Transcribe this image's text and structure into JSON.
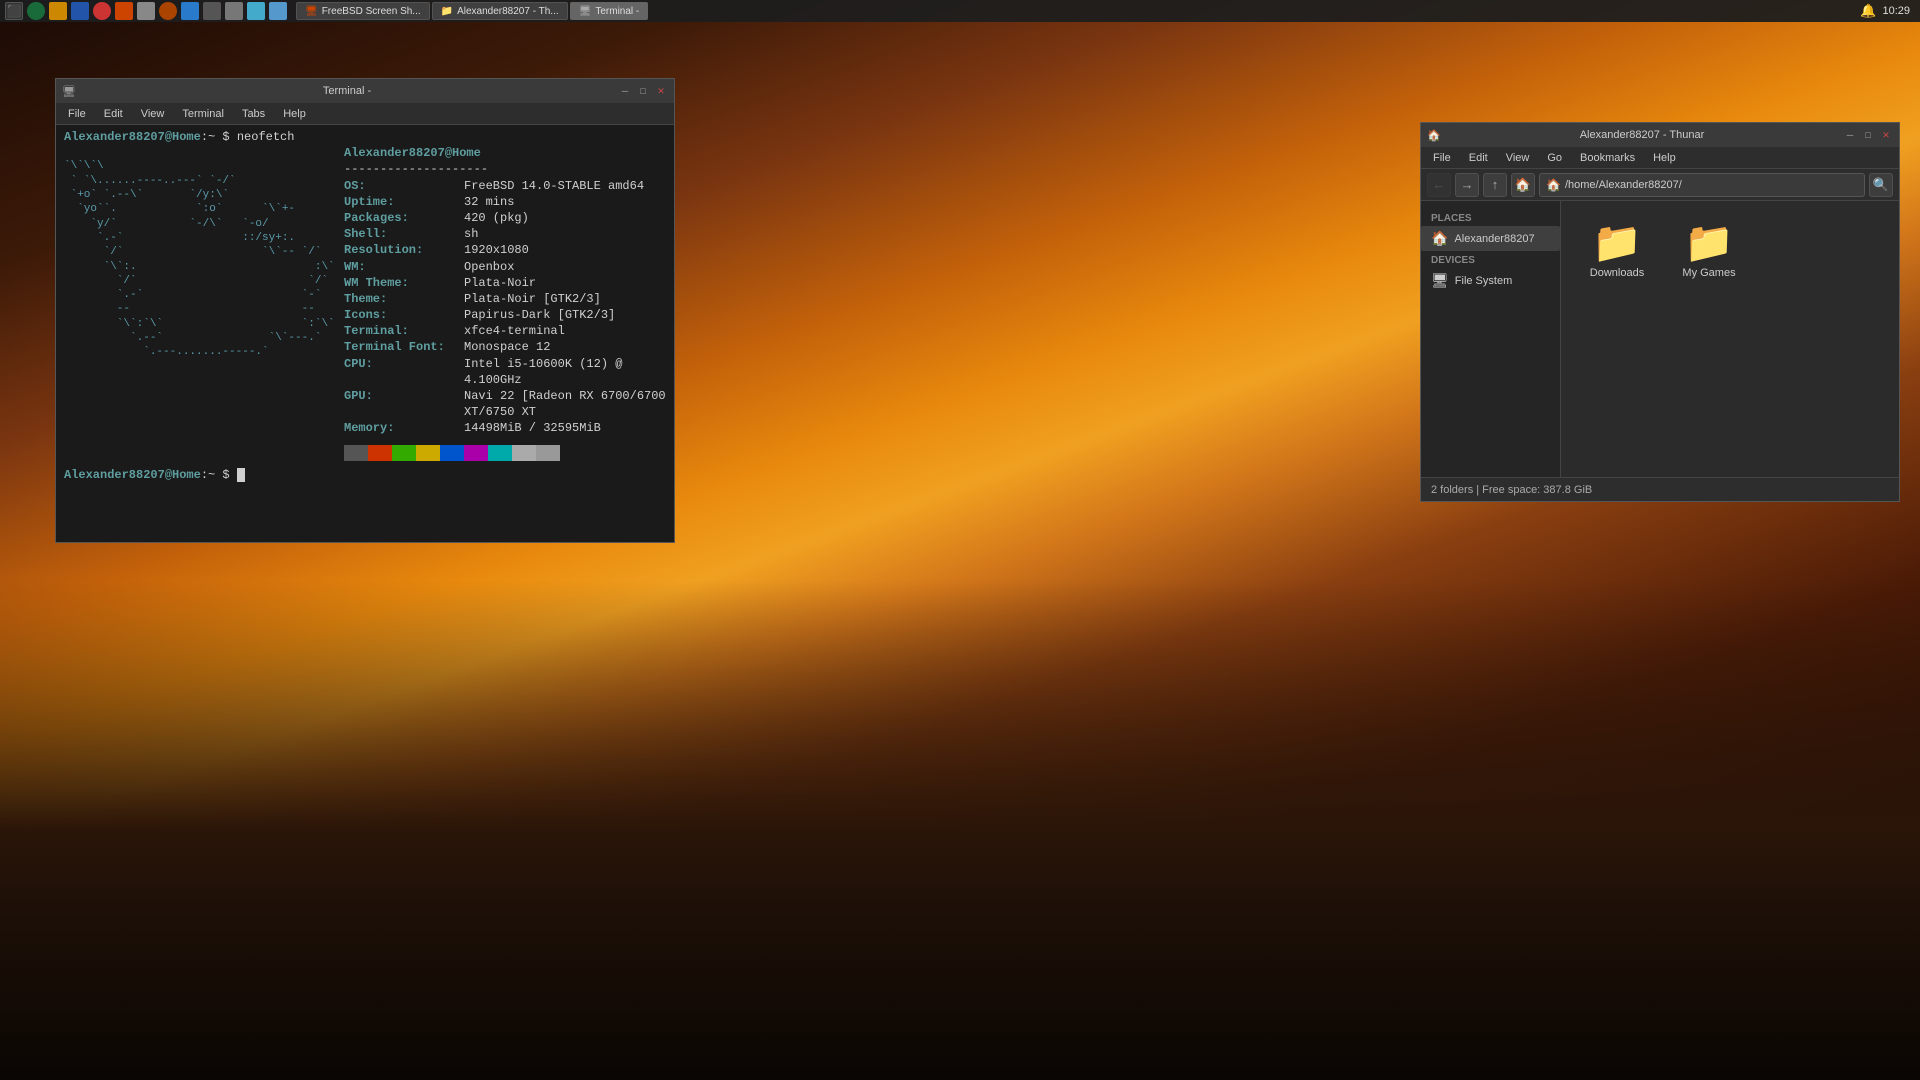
{
  "desktop": {
    "background_description": "Forest sunset with orange glow"
  },
  "taskbar": {
    "time": "10:29",
    "icons": [
      "🐉",
      "📁",
      "🌐",
      "🖥",
      "⚙",
      "🔥",
      "📺",
      "🎵",
      "📧",
      "🖼",
      "⚡",
      "📌",
      "💻",
      "🔧"
    ],
    "windows": [
      {
        "label": "FreeBSD Screen Sh...",
        "active": false
      },
      {
        "label": "Alexander88207 - Th...",
        "active": false
      },
      {
        "label": "Terminal -",
        "active": true
      }
    ]
  },
  "terminal": {
    "title": "Terminal -",
    "menus": [
      "File",
      "Edit",
      "View",
      "Terminal",
      "Tabs",
      "Help"
    ],
    "prompt": "Alexander88207@Home:~ $",
    "command": "neofetch",
    "neofetch": {
      "user_host": "Alexander88207@Home",
      "separator": "--------------------",
      "os": "FreeBSD 14.0-STABLE amd64",
      "uptime": "32 mins",
      "packages": "420 (pkg)",
      "shell": "sh",
      "resolution": "1920x1080",
      "wm": "Openbox",
      "wm_theme": "Plata-Noir",
      "theme": "Plata-Noir [GTK2/3]",
      "icons": "Papirus-Dark [GTK2/3]",
      "terminal": "xfce4-terminal",
      "terminal_font": "Monospace 12",
      "cpu": "Intel i5-10600K (12) @ 4.100GHz",
      "gpu": "Navi 22 [Radeon RX 6700/6700 XT/6750 XT",
      "memory": "14498MiB / 32595MiB"
    },
    "prompt2": "Alexander88207@Home:~ $",
    "colors": [
      "#555555",
      "#cc3300",
      "#33aa00",
      "#ccaa00",
      "#0055cc",
      "#aa00aa",
      "#00aaaa",
      "#aaaaaa",
      "#999999",
      "#ff5555",
      "#55ff55",
      "#ffff55",
      "#5555ff",
      "#ff55ff",
      "#55ffff",
      "#ffffff"
    ]
  },
  "filemanager": {
    "title": "Alexander88207 - Thunar",
    "menus": [
      "File",
      "Edit",
      "View",
      "Go",
      "Bookmarks",
      "Help"
    ],
    "address": "/home/Alexander88207/",
    "sidebar": {
      "places_label": "Places",
      "places": [
        {
          "name": "Alexander88207",
          "icon": "🏠"
        }
      ],
      "devices_label": "Devices",
      "devices": [
        {
          "name": "File System",
          "icon": "🖥"
        }
      ]
    },
    "folders": [
      {
        "name": "Downloads",
        "icon": "📁"
      },
      {
        "name": "My Games",
        "icon": "📁"
      }
    ],
    "statusbar": "2 folders | Free space: 387.8 GiB"
  }
}
